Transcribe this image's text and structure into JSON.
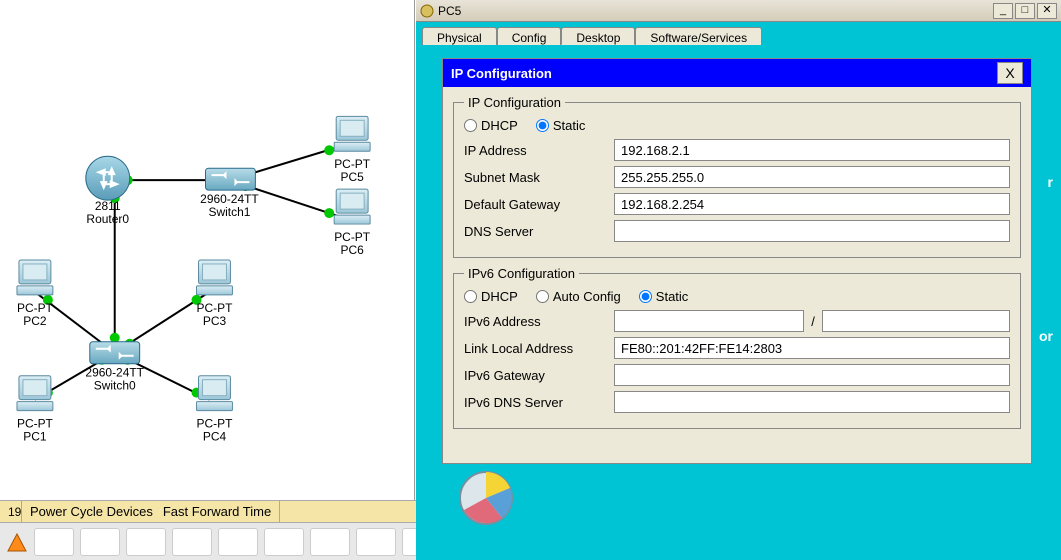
{
  "topology": {
    "nodes": {
      "router0": {
        "name": "2811",
        "label": "Router0"
      },
      "switch1": {
        "name": "2960-24TT",
        "label": "Switch1"
      },
      "switch0": {
        "name": "2960-24TT",
        "label": "Switch0"
      },
      "pc1": {
        "type": "PC-PT",
        "name": "PC1"
      },
      "pc2": {
        "type": "PC-PT",
        "name": "PC2"
      },
      "pc3": {
        "type": "PC-PT",
        "name": "PC3"
      },
      "pc4": {
        "type": "PC-PT",
        "name": "PC4"
      },
      "pc5": {
        "type": "PC-PT",
        "name": "PC5"
      },
      "pc6": {
        "type": "PC-PT",
        "name": "PC6"
      }
    }
  },
  "statusbar": {
    "cell1": "19",
    "powerCycle": "Power Cycle Devices",
    "fastForward": "Fast Forward Time"
  },
  "pcwindow": {
    "title": "PC5",
    "tabs": {
      "physical": "Physical",
      "config": "Config",
      "desktop": "Desktop",
      "software": "Software/Services"
    },
    "ipConfigTitle": "IP Configuration",
    "closeX": "X",
    "ipv4": {
      "legend": "IP Configuration",
      "dhcp": "DHCP",
      "static": "Static",
      "mode": "static",
      "ipLabel": "IP Address",
      "ip": "192.168.2.1",
      "maskLabel": "Subnet Mask",
      "mask": "255.255.255.0",
      "gwLabel": "Default Gateway",
      "gw": "192.168.2.254",
      "dnsLabel": "DNS Server",
      "dns": ""
    },
    "ipv6": {
      "legend": "IPv6 Configuration",
      "dhcp": "DHCP",
      "auto": "Auto Config",
      "static": "Static",
      "mode": "static",
      "addrLabel": "IPv6 Address",
      "addr": "",
      "prefix": "",
      "llLabel": "Link Local Address",
      "ll": "FE80::201:42FF:FE14:2803",
      "gwLabel": "IPv6 Gateway",
      "gw": "",
      "dnsLabel": "IPv6 DNS Server",
      "dns": ""
    },
    "rightHint1": "r",
    "rightHint2": "or"
  }
}
